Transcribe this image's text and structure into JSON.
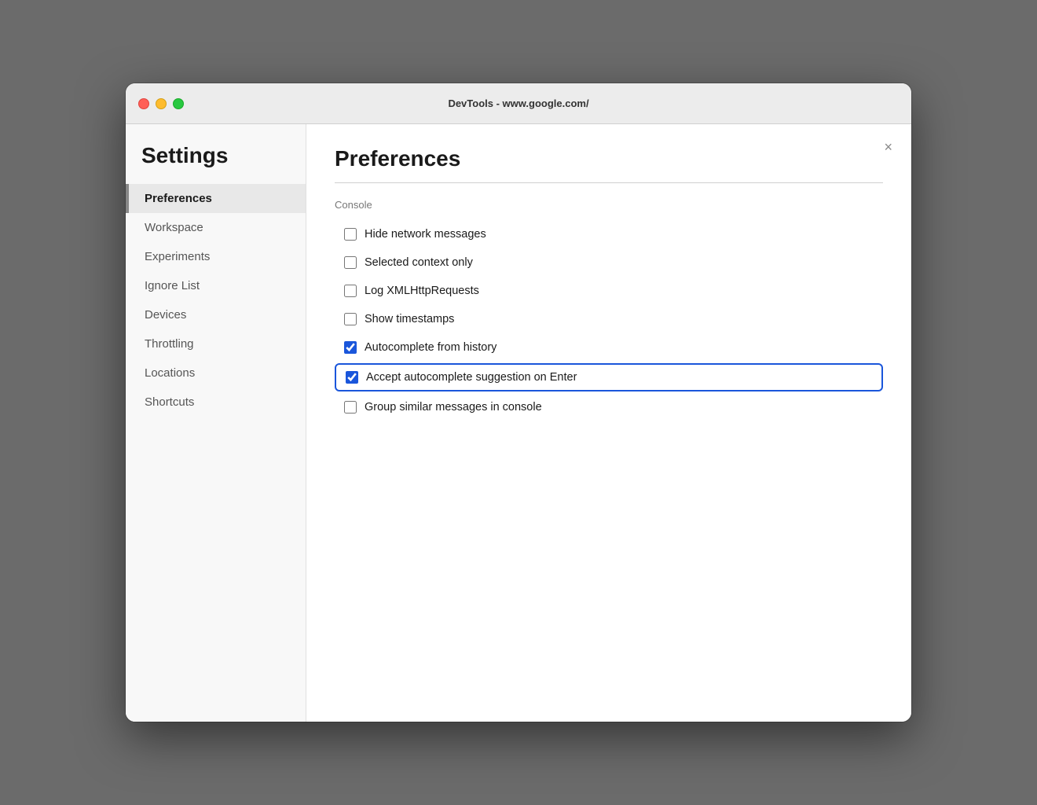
{
  "titlebar": {
    "title": "DevTools - www.google.com/"
  },
  "sidebar": {
    "heading": "Settings",
    "items": [
      {
        "id": "preferences",
        "label": "Preferences",
        "active": true
      },
      {
        "id": "workspace",
        "label": "Workspace",
        "active": false
      },
      {
        "id": "experiments",
        "label": "Experiments",
        "active": false
      },
      {
        "id": "ignore-list",
        "label": "Ignore List",
        "active": false
      },
      {
        "id": "devices",
        "label": "Devices",
        "active": false
      },
      {
        "id": "throttling",
        "label": "Throttling",
        "active": false
      },
      {
        "id": "locations",
        "label": "Locations",
        "active": false
      },
      {
        "id": "shortcuts",
        "label": "Shortcuts",
        "active": false
      }
    ]
  },
  "main": {
    "title": "Preferences",
    "close_label": "×",
    "section_label": "Console",
    "checkboxes": [
      {
        "id": "hide-network",
        "label": "Hide network messages",
        "checked": false,
        "highlighted": false
      },
      {
        "id": "selected-context",
        "label": "Selected context only",
        "checked": false,
        "highlighted": false
      },
      {
        "id": "log-xmlhttp",
        "label": "Log XMLHttpRequests",
        "checked": false,
        "highlighted": false
      },
      {
        "id": "show-timestamps",
        "label": "Show timestamps",
        "checked": false,
        "highlighted": false
      },
      {
        "id": "autocomplete-history",
        "label": "Autocomplete from history",
        "checked": true,
        "highlighted": false
      },
      {
        "id": "accept-autocomplete",
        "label": "Accept autocomplete suggestion on Enter",
        "checked": true,
        "highlighted": true
      },
      {
        "id": "group-similar",
        "label": "Group similar messages in console",
        "checked": false,
        "highlighted": false
      }
    ]
  }
}
